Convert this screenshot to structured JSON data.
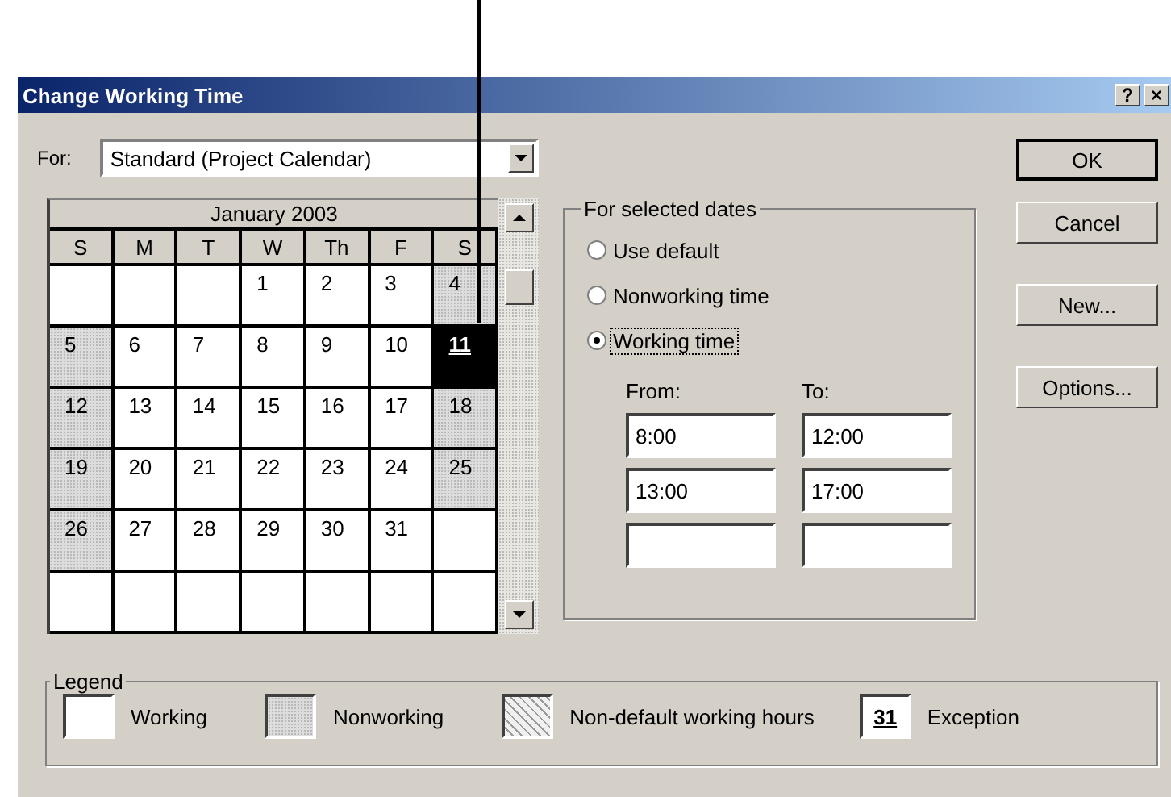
{
  "window": {
    "title": "Change Working Time",
    "buttons": [
      "?",
      "×"
    ]
  },
  "for_field": {
    "label": "For:",
    "value": "Standard (Project Calendar)"
  },
  "calendar": {
    "month": "January 2003",
    "weekdays": [
      "S",
      "M",
      "T",
      "W",
      "Th",
      "F",
      "S"
    ],
    "weeks": [
      [
        {
          "kind": "blank"
        },
        {
          "kind": "blank"
        },
        {
          "kind": "blank"
        },
        {
          "kind": "day",
          "day": "1",
          "nonworking": false,
          "selected": false
        },
        {
          "kind": "day",
          "day": "2",
          "nonworking": false,
          "selected": false
        },
        {
          "kind": "day",
          "day": "3",
          "nonworking": false,
          "selected": false
        },
        {
          "kind": "day",
          "day": "4",
          "nonworking": true,
          "selected": false
        }
      ],
      [
        {
          "kind": "day",
          "day": "5",
          "nonworking": true,
          "selected": false
        },
        {
          "kind": "day",
          "day": "6",
          "nonworking": false,
          "selected": false
        },
        {
          "kind": "day",
          "day": "7",
          "nonworking": false,
          "selected": false
        },
        {
          "kind": "day",
          "day": "8",
          "nonworking": false,
          "selected": false
        },
        {
          "kind": "day",
          "day": "9",
          "nonworking": false,
          "selected": false
        },
        {
          "kind": "day",
          "day": "10",
          "nonworking": false,
          "selected": false
        },
        {
          "kind": "day",
          "day": "11",
          "selected": true,
          "exception": true
        }
      ],
      [
        {
          "kind": "day",
          "day": "12",
          "nonworking": true,
          "selected": false
        },
        {
          "kind": "day",
          "day": "13",
          "nonworking": false,
          "selected": false
        },
        {
          "kind": "day",
          "day": "14",
          "nonworking": false,
          "selected": false
        },
        {
          "kind": "day",
          "day": "15",
          "nonworking": false,
          "selected": false
        },
        {
          "kind": "day",
          "day": "16",
          "nonworking": false,
          "selected": false
        },
        {
          "kind": "day",
          "day": "17",
          "nonworking": false,
          "selected": false
        },
        {
          "kind": "day",
          "day": "18",
          "nonworking": true,
          "selected": false
        }
      ],
      [
        {
          "kind": "day",
          "day": "19",
          "nonworking": true,
          "selected": false
        },
        {
          "kind": "day",
          "day": "20",
          "nonworking": false,
          "selected": false
        },
        {
          "kind": "day",
          "day": "21",
          "nonworking": false,
          "selected": false
        },
        {
          "kind": "day",
          "day": "22",
          "nonworking": false,
          "selected": false
        },
        {
          "kind": "day",
          "day": "23",
          "nonworking": false,
          "selected": false
        },
        {
          "kind": "day",
          "day": "24",
          "nonworking": false,
          "selected": false
        },
        {
          "kind": "day",
          "day": "25",
          "nonworking": true,
          "selected": false
        }
      ],
      [
        {
          "kind": "day",
          "day": "26",
          "nonworking": true,
          "selected": false
        },
        {
          "kind": "day",
          "day": "27",
          "nonworking": false,
          "selected": false
        },
        {
          "kind": "day",
          "day": "28",
          "nonworking": false,
          "selected": false
        },
        {
          "kind": "day",
          "day": "29",
          "nonworking": false,
          "selected": false
        },
        {
          "kind": "day",
          "day": "30",
          "nonworking": false,
          "selected": false
        },
        {
          "kind": "day",
          "day": "31",
          "nonworking": false,
          "selected": false
        },
        {
          "kind": "blank"
        }
      ],
      [
        {
          "kind": "blank"
        },
        {
          "kind": "blank"
        },
        {
          "kind": "blank"
        },
        {
          "kind": "blank"
        },
        {
          "kind": "blank"
        },
        {
          "kind": "blank"
        },
        {
          "kind": "blank"
        }
      ]
    ]
  },
  "selected_dates": {
    "title": "For selected dates",
    "options": [
      {
        "label": "Use default",
        "selected": false,
        "focused": false
      },
      {
        "label": "Nonworking time",
        "selected": false,
        "focused": false
      },
      {
        "label": "Working time",
        "selected": true,
        "focused": true
      }
    ],
    "from_label": "From:",
    "to_label": "To:",
    "times": [
      {
        "kind": "filled",
        "from": "8:00",
        "to": "12:00"
      },
      {
        "kind": "filled",
        "from": "13:00",
        "to": "17:00"
      },
      {
        "kind": "empty"
      }
    ]
  },
  "buttons": [
    {
      "label": "OK",
      "default": true
    },
    {
      "label": "Cancel",
      "default": false
    },
    {
      "label": "New...",
      "default": false
    },
    {
      "label": "Options...",
      "default": false
    }
  ],
  "legend": {
    "title": "Legend",
    "items": [
      {
        "kind": "working",
        "label": "Working"
      },
      {
        "kind": "nonworking",
        "label": "Nonworking"
      },
      {
        "kind": "nondefault",
        "label": "Non-default working hours"
      },
      {
        "kind": "exception",
        "label": "Exception",
        "sample": "31"
      }
    ]
  }
}
